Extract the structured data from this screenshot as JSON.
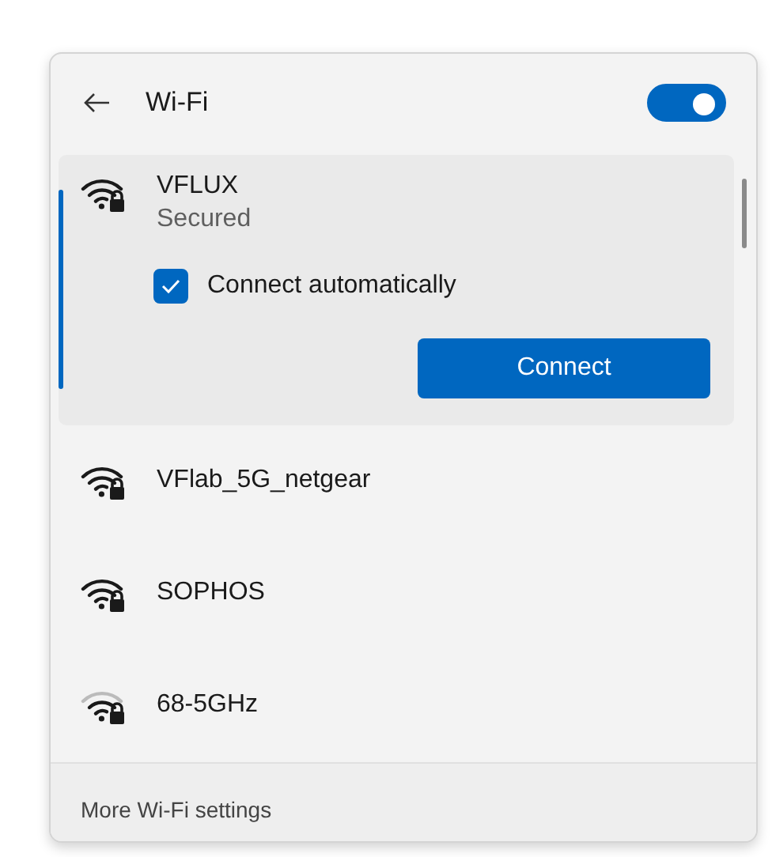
{
  "header": {
    "title": "Wi-Fi",
    "wifi_on": true
  },
  "networks": [
    {
      "name": "VFLUX",
      "status": "Secured",
      "selected": true,
      "weak_signal": false,
      "connect_automatically": {
        "label": "Connect automatically",
        "checked": true
      },
      "button": "Connect"
    },
    {
      "name": "VFlab_5G_netgear",
      "selected": false,
      "weak_signal": false
    },
    {
      "name": "SOPHOS",
      "selected": false,
      "weak_signal": false
    },
    {
      "name": "68-5GHz",
      "selected": false,
      "weak_signal": true
    }
  ],
  "footer": {
    "link": "More Wi-Fi settings"
  }
}
